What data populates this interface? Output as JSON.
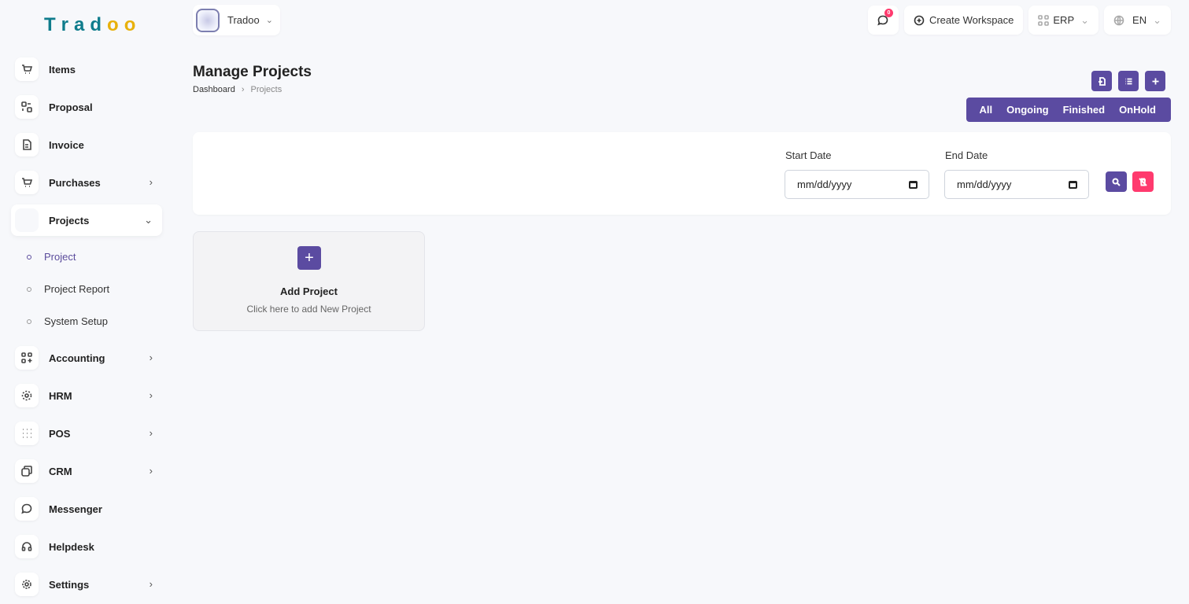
{
  "app": {
    "logo_text": "Tradoo"
  },
  "workspace": {
    "name": "Tradoo"
  },
  "header": {
    "message_count": "0",
    "create_workspace": "Create Workspace",
    "module": "ERP",
    "language": "EN"
  },
  "sidebar": {
    "items": [
      {
        "label": "Items",
        "icon": "cart-icon"
      },
      {
        "label": "Proposal",
        "icon": "proposal-icon"
      },
      {
        "label": "Invoice",
        "icon": "invoice-icon"
      },
      {
        "label": "Purchases",
        "icon": "cart-icon"
      },
      {
        "label": "Projects",
        "icon": "projects-icon"
      },
      {
        "label": "Accounting",
        "icon": "apps-icon"
      },
      {
        "label": "HRM",
        "icon": "hrm-icon"
      },
      {
        "label": "POS",
        "icon": "grid-icon"
      },
      {
        "label": "CRM",
        "icon": "layers-icon"
      },
      {
        "label": "Messenger",
        "icon": "chat-icon"
      },
      {
        "label": "Helpdesk",
        "icon": "headset-icon"
      },
      {
        "label": "Settings",
        "icon": "gear-icon"
      }
    ],
    "projects_sub": [
      "Project",
      "Project Report",
      "System Setup"
    ]
  },
  "page": {
    "title": "Manage Projects",
    "breadcrumb": [
      "Dashboard",
      "Projects"
    ],
    "filters": [
      "All",
      "Ongoing",
      "Finished",
      "OnHold"
    ]
  },
  "filter_card": {
    "start_label": "Start Date",
    "end_label": "End Date",
    "start_value": "mm/dd/yyyy",
    "end_value": "mm/dd/yyyy"
  },
  "add_project": {
    "title": "Add Project",
    "subtitle": "Click here to add New Project"
  },
  "colors": {
    "accent": "#5b4ba1",
    "danger": "#ff3a6e",
    "logo_teal": "#0f7c8c",
    "logo_gold": "#e8b10c"
  }
}
